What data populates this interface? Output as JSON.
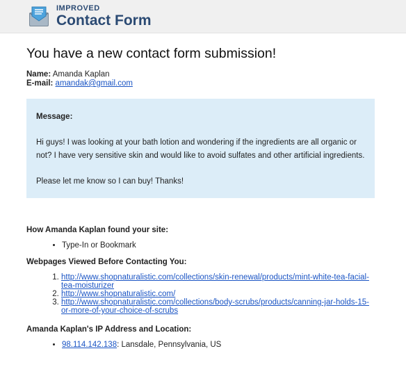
{
  "header": {
    "logo_small": "IMPROVED",
    "logo_big": "Contact Form"
  },
  "email": {
    "title": "You have a new contact form submission!",
    "name_label": "Name:",
    "name_value": "Amanda Kaplan",
    "email_label": "E-mail:",
    "email_value": "amandak@gmail.com",
    "message_label": "Message:",
    "message_p1": "Hi guys! I was looking at your bath lotion and wondering if the ingredients are all organic or not? I have very sensitive skin and would like to avoid sulfates and other artificial ingredients.",
    "message_p2": "Please let me know so I can buy! Thanks!",
    "found_heading": "How Amanda Kaplan found your site:",
    "found_items": [
      "Type-In or Bookmark"
    ],
    "viewed_heading": "Webpages Viewed Before Contacting You:",
    "viewed_pages": [
      "http://www.shopnaturalistic.com/collections/skin-renewal/products/mint-white-tea-facial-tea-moisturizer",
      "http://www.shopnaturalistic.com/",
      "http://www.shopnaturalistic.com/collections/body-scrubs/products/canning-jar-holds-15-or-more-of-your-choice-of-scrubs"
    ],
    "ip_heading": "Amanda Kaplan's IP Address and Location:",
    "ip_address": "98.114.142.138",
    "ip_location": ": Lansdale, Pennsylvania, US"
  },
  "colors": {
    "header_bg": "#f0f0f0",
    "logo_text": "#2b4a73",
    "message_bg": "#dcedf8",
    "link": "#1a54c4"
  },
  "icons": {
    "logo": "envelope-icon"
  }
}
